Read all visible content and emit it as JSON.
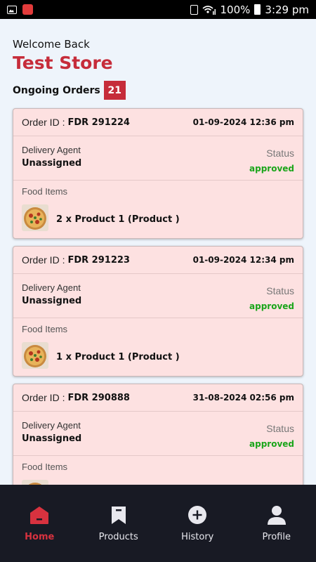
{
  "status_bar": {
    "battery": "100%",
    "time": "3:29 pm"
  },
  "header": {
    "welcome": "Welcome Back",
    "store_name": "Test Store",
    "ongoing_label": "Ongoing Orders",
    "ongoing_count": "21"
  },
  "labels": {
    "order_id": "Order ID :",
    "delivery_agent": "Delivery Agent",
    "status": "Status",
    "food_items": "Food Items"
  },
  "orders": [
    {
      "id": "FDR 291224",
      "date": "01-09-2024 12:36 pm",
      "agent": "Unassigned",
      "status": "approved",
      "item": "2 x Product 1 (Product )"
    },
    {
      "id": "FDR 291223",
      "date": "01-09-2024 12:34 pm",
      "agent": "Unassigned",
      "status": "approved",
      "item": "1 x Product 1 (Product )"
    },
    {
      "id": "FDR 290888",
      "date": "31-08-2024 02:56 pm",
      "agent": "Unassigned",
      "status": "approved",
      "item": ""
    }
  ],
  "nav": [
    {
      "label": "Home",
      "icon": "home-icon",
      "active": true
    },
    {
      "label": "Products",
      "icon": "bookmark-icon",
      "active": false
    },
    {
      "label": "History",
      "icon": "plus-circle-icon",
      "active": false
    },
    {
      "label": "Profile",
      "icon": "person-icon",
      "active": false
    }
  ],
  "colors": {
    "accent": "#c62c3a",
    "card_bg": "#fde1e1",
    "status_green": "#1aa51a",
    "nav_bg": "#181a24"
  }
}
